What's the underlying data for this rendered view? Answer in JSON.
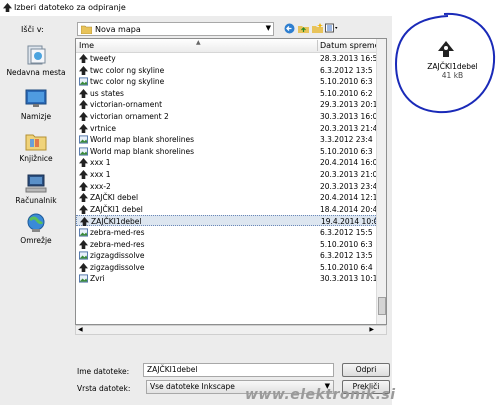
{
  "window": {
    "title": "Izberi datoteko za odpiranje"
  },
  "lookin": {
    "label": "Išči v:",
    "value": "Nova mapa"
  },
  "places": [
    {
      "label": "Nedavna mesta",
      "icon": "recent-places-icon"
    },
    {
      "label": "Namizje",
      "icon": "desktop-icon"
    },
    {
      "label": "Knjižnice",
      "icon": "libraries-icon"
    },
    {
      "label": "Računalnik",
      "icon": "computer-icon"
    },
    {
      "label": "Omrežje",
      "icon": "network-icon"
    }
  ],
  "columns": {
    "name": "Ime",
    "date": "Datum spremembe"
  },
  "files": [
    {
      "name": "tweety",
      "date": "28.3.2013 16:5",
      "icon": "inkscape-file-icon"
    },
    {
      "name": "twc color ng skyline",
      "date": "6.3.2012 13:5",
      "icon": "inkscape-file-icon"
    },
    {
      "name": "twc color ng skyline",
      "date": "5.10.2010 6:3",
      "icon": "image-file-icon"
    },
    {
      "name": "us states",
      "date": "5.10.2010 6:2",
      "icon": "inkscape-file-icon"
    },
    {
      "name": "victorian-ornament",
      "date": "29.3.2013 20:1",
      "icon": "inkscape-file-icon"
    },
    {
      "name": "victorian ornament 2",
      "date": "30.3.2013 16:0",
      "icon": "inkscape-file-icon"
    },
    {
      "name": "vrtnice",
      "date": "20.3.2013 21:4",
      "icon": "inkscape-file-icon"
    },
    {
      "name": "World map blank shorelines",
      "date": "3.3.2012 23:4",
      "icon": "image-file-icon"
    },
    {
      "name": "World map blank shorelines",
      "date": "5.10.2010 6:3",
      "icon": "image-file-icon"
    },
    {
      "name": "xxx 1",
      "date": "20.4.2014 16:0",
      "icon": "inkscape-file-icon"
    },
    {
      "name": "xxx 1",
      "date": "20.3.2013 21:0",
      "icon": "inkscape-file-icon"
    },
    {
      "name": "xxx-2",
      "date": "20.3.2013 23:4",
      "icon": "inkscape-file-icon"
    },
    {
      "name": "ZAJČKI debel",
      "date": "20.4.2014 12:1",
      "icon": "inkscape-file-icon"
    },
    {
      "name": "ZAJČKI1 debel",
      "date": "18.4.2014 20:4",
      "icon": "inkscape-file-icon"
    },
    {
      "name": "ZAJČKI1debel",
      "date": "19.4.2014 10:0",
      "icon": "inkscape-file-icon",
      "selected": true
    },
    {
      "name": "zebra-med-res",
      "date": "6.3.2012 15:5",
      "icon": "image-file-icon"
    },
    {
      "name": "zebra-med-res",
      "date": "5.10.2010 6:3",
      "icon": "inkscape-file-icon"
    },
    {
      "name": "zigzagdissolve",
      "date": "6.3.2012 13:5",
      "icon": "image-file-icon"
    },
    {
      "name": "zigzagdissolve",
      "date": "5.10.2010 6:4",
      "icon": "inkscape-file-icon"
    },
    {
      "name": "Zvri",
      "date": "30.3.2013 10:1",
      "icon": "image-file-icon"
    }
  ],
  "filename": {
    "label": "Ime datoteke:",
    "value": "ZAJČKI1debel"
  },
  "filetype": {
    "label": "Vrsta datotek:",
    "value": "Vse datoteke Inkscape"
  },
  "buttons": {
    "open": "Odpri",
    "cancel": "Prekliči"
  },
  "preview": {
    "name": "ZAJČKI1debel",
    "size": "41 kB"
  },
  "watermark": "www.elektronik.si"
}
